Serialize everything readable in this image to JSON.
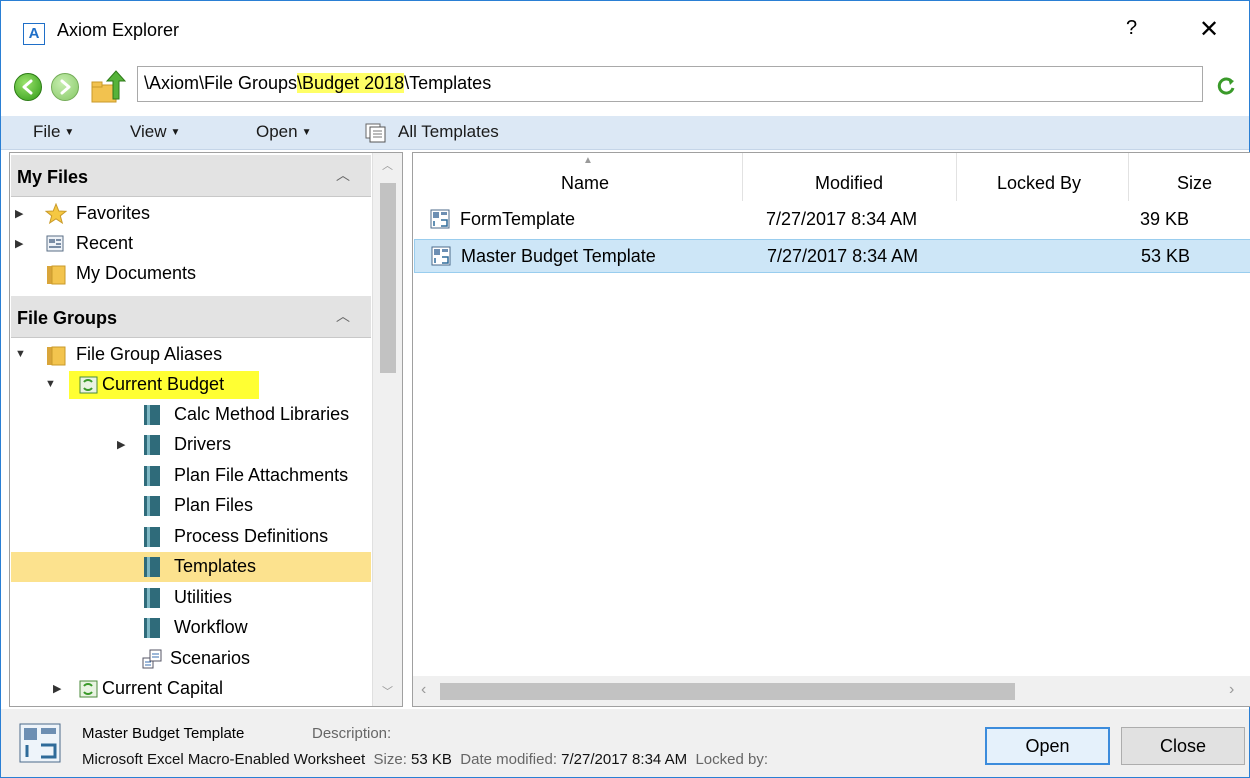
{
  "window": {
    "title": "Axiom Explorer",
    "app_icon": "A",
    "help": "?",
    "close": "✕"
  },
  "address": {
    "path_before": "\\Axiom\\File Groups",
    "path_highlight": "\\Budget 2018",
    "path_after": "\\Templates"
  },
  "menu": {
    "file": "File",
    "view": "View",
    "open": "Open",
    "all_templates": "All Templates"
  },
  "left": {
    "my_files_header": "My Files",
    "my_files": [
      {
        "label": "Favorites",
        "icon": "star-icon"
      },
      {
        "label": "Recent",
        "icon": "recent-icon"
      },
      {
        "label": "My Documents",
        "icon": "folder-icon"
      }
    ],
    "file_groups_header": "File Groups",
    "tree": {
      "aliases": "File Group Aliases",
      "current_budget": "Current Budget",
      "children": [
        "Calc Method Libraries",
        "Drivers",
        "Plan File Attachments",
        "Plan Files",
        "Process Definitions",
        "Templates",
        "Utilities",
        "Workflow",
        "Scenarios"
      ],
      "current_capital": "Current Capital"
    }
  },
  "list": {
    "columns": [
      "Name",
      "Modified",
      "Locked By",
      "Size"
    ],
    "rows": [
      {
        "name": "FormTemplate",
        "modified": "7/27/2017 8:34 AM",
        "locked_by": "",
        "size": "39 KB"
      },
      {
        "name": "Master Budget Template",
        "modified": "7/27/2017 8:34 AM",
        "locked_by": "",
        "size": "53 KB"
      }
    ]
  },
  "details": {
    "name": "Master Budget Template",
    "description_label": "Description:",
    "type": "Microsoft Excel Macro-Enabled Worksheet",
    "size_label": "Size:",
    "size": "53 KB",
    "modified_label": "Date modified:",
    "modified": "7/27/2017 8:34 AM",
    "locked_label": "Locked by:"
  },
  "buttons": {
    "open": "Open",
    "close": "Close"
  },
  "colors": {
    "highlight_yellow": "#ffff33",
    "selected_tree": "#fce28e",
    "selected_row": "#cde6f7",
    "menubar": "#dce8f5"
  }
}
